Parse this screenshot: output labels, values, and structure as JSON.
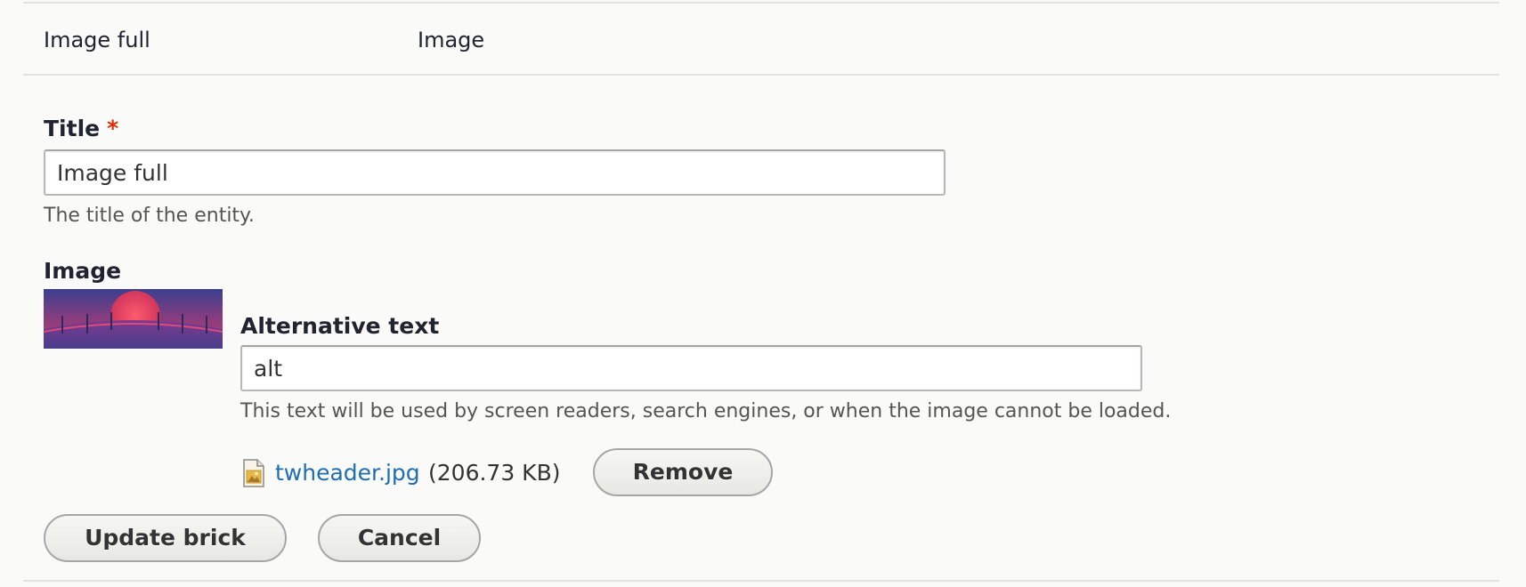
{
  "table_row": {
    "title_cell": "Image full",
    "type_cell": "Image"
  },
  "form": {
    "title_field": {
      "label": "Title",
      "required_mark": "*",
      "value": "Image full",
      "description": "The title of the entity."
    },
    "image_field": {
      "label": "Image",
      "alt_text": {
        "label": "Alternative text",
        "value": "alt",
        "description": "This text will be used by screen readers, search engines, or when the image cannot be loaded."
      },
      "file": {
        "name": "twheader.jpg",
        "size": "(206.73 KB)",
        "icon": "image-file-icon"
      },
      "remove_label": "Remove"
    },
    "actions": {
      "update_label": "Update brick",
      "cancel_label": "Cancel"
    }
  },
  "colors": {
    "background": "#fafaf8",
    "link": "#1f6eb2",
    "required": "#e32700",
    "rule": "#e3e2de"
  }
}
